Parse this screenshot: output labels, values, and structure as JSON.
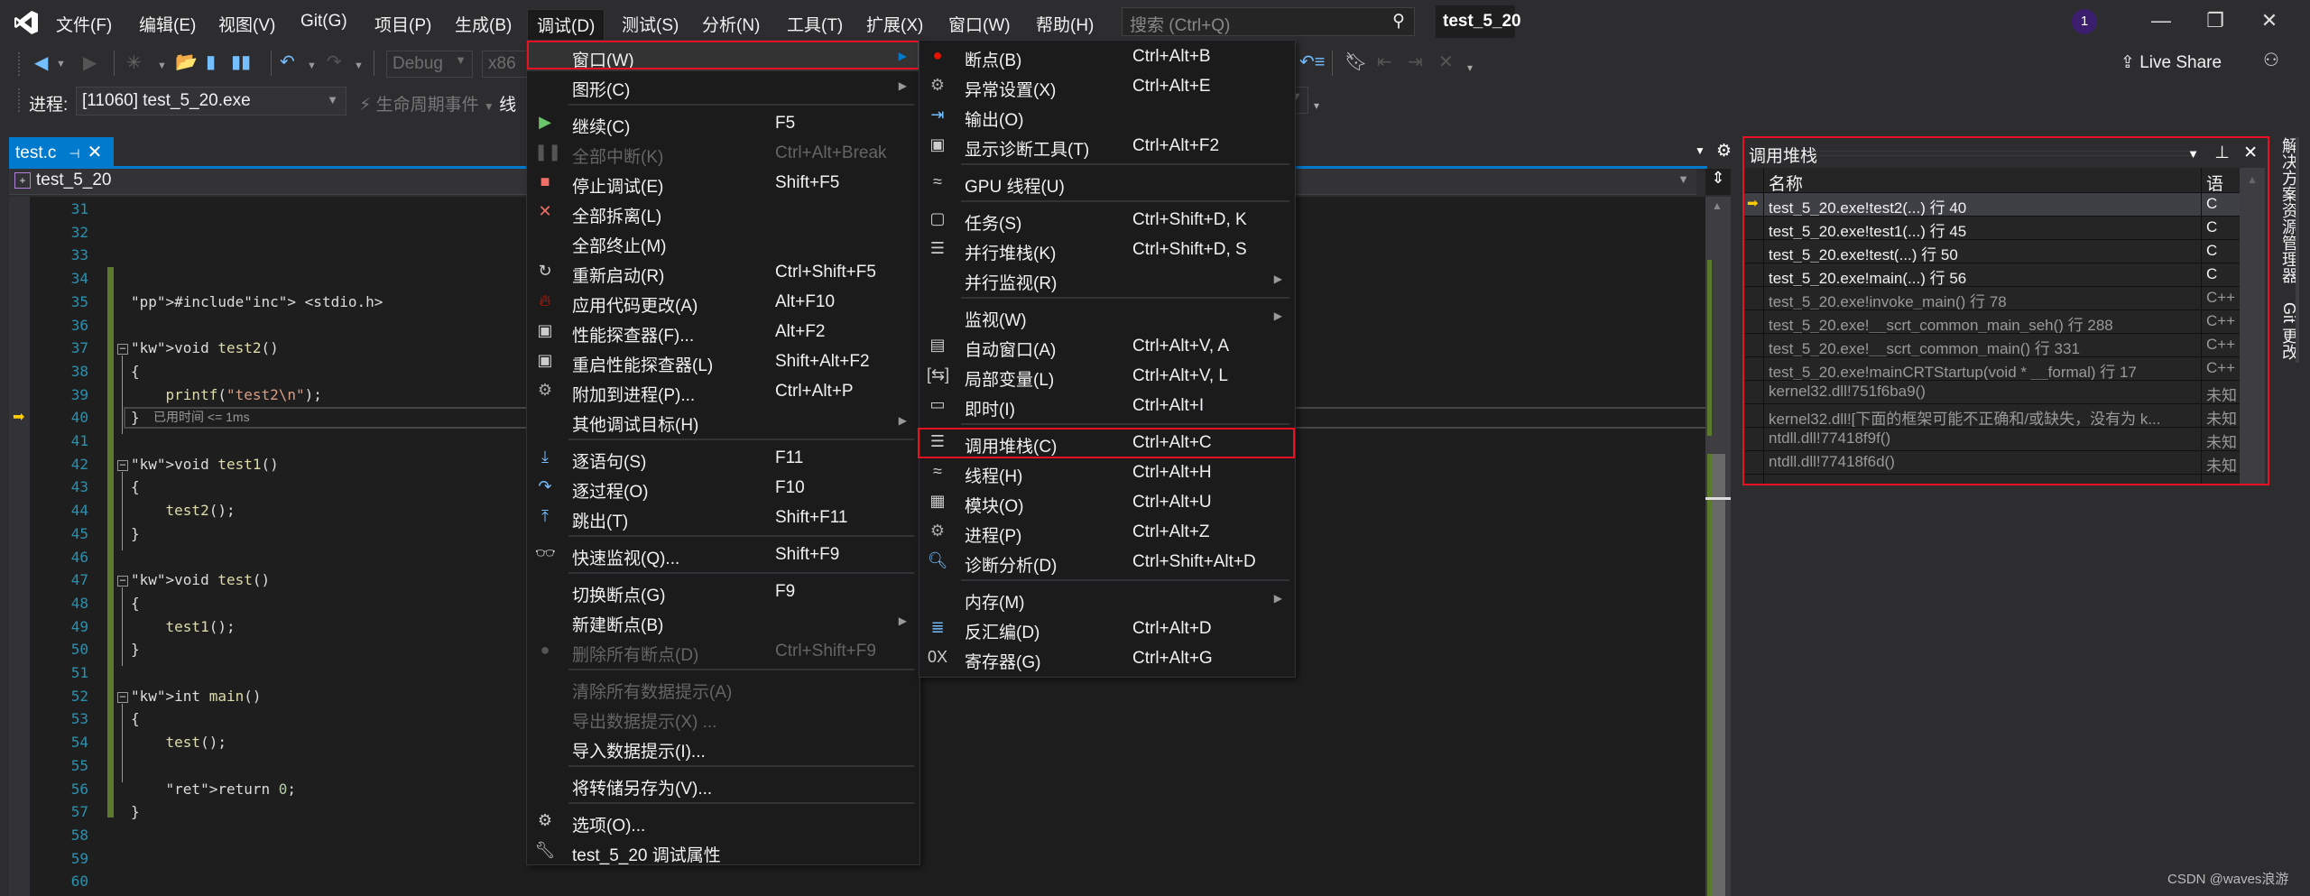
{
  "menubar": {
    "items": [
      "文件(F)",
      "编辑(E)",
      "视图(V)",
      "Git(G)",
      "项目(P)",
      "生成(B)",
      "调试(D)",
      "测试(S)",
      "分析(N)",
      "工具(T)",
      "扩展(X)",
      "窗口(W)",
      "帮助(H)"
    ],
    "active_index": 6,
    "search_placeholder": "搜索 (Ctrl+Q)",
    "solution_name": "test_5_20",
    "notification_count": "1",
    "window_buttons": {
      "minimize": "—",
      "restore": "❐",
      "close": "✕"
    }
  },
  "toolbar": {
    "config": "Debug",
    "platform": "x86",
    "process_label": "进程:",
    "process_value": "[11060] test_5_20.exe",
    "lifecycle_label": "生命周期事件",
    "thread_label": "线",
    "live_share": "Live Share"
  },
  "editor": {
    "tab_label": "test.c",
    "project_nav": "test_5_20",
    "elapsed_time": "已用时间 <= 1ms",
    "current_line": 40,
    "lines": [
      {
        "n": "31",
        "html": ""
      },
      {
        "n": "32",
        "html": ""
      },
      {
        "n": "33",
        "html": ""
      },
      {
        "n": "34",
        "html": ""
      },
      {
        "n": "35",
        "html": "#include <stdio.h>"
      },
      {
        "n": "36",
        "html": ""
      },
      {
        "n": "37",
        "html": "void test2()"
      },
      {
        "n": "38",
        "html": "{"
      },
      {
        "n": "39",
        "html": "    printf(\"test2\\n\");"
      },
      {
        "n": "40",
        "html": "}"
      },
      {
        "n": "41",
        "html": ""
      },
      {
        "n": "42",
        "html": "void test1()"
      },
      {
        "n": "43",
        "html": "{"
      },
      {
        "n": "44",
        "html": "    test2();"
      },
      {
        "n": "45",
        "html": "}"
      },
      {
        "n": "46",
        "html": ""
      },
      {
        "n": "47",
        "html": "void test()"
      },
      {
        "n": "48",
        "html": "{"
      },
      {
        "n": "49",
        "html": "    test1();"
      },
      {
        "n": "50",
        "html": "}"
      },
      {
        "n": "51",
        "html": ""
      },
      {
        "n": "52",
        "html": "int main()"
      },
      {
        "n": "53",
        "html": "{"
      },
      {
        "n": "54",
        "html": "    test();"
      },
      {
        "n": "55",
        "html": ""
      },
      {
        "n": "56",
        "html": "    return 0;"
      },
      {
        "n": "57",
        "html": "}"
      },
      {
        "n": "58",
        "html": ""
      },
      {
        "n": "59",
        "html": ""
      },
      {
        "n": "60",
        "html": ""
      }
    ]
  },
  "debug_menu": {
    "items": [
      {
        "label": "窗口(W)",
        "shortcut": "",
        "icon": "",
        "submenu": true,
        "highlighted": true
      },
      {
        "label": "图形(C)",
        "shortcut": "",
        "icon": "",
        "submenu": true
      },
      {
        "sep": true
      },
      {
        "label": "继续(C)",
        "shortcut": "F5",
        "icon": "play-icon"
      },
      {
        "label": "全部中断(K)",
        "shortcut": "Ctrl+Alt+Break",
        "icon": "pause-icon",
        "disabled": true
      },
      {
        "label": "停止调试(E)",
        "shortcut": "Shift+F5",
        "icon": "stop-icon"
      },
      {
        "label": "全部拆离(L)",
        "shortcut": "",
        "icon": "detach-icon"
      },
      {
        "label": "全部终止(M)",
        "shortcut": "",
        "icon": ""
      },
      {
        "label": "重新启动(R)",
        "shortcut": "Ctrl+Shift+F5",
        "icon": "restart-icon"
      },
      {
        "label": "应用代码更改(A)",
        "shortcut": "Alt+F10",
        "icon": "hot-reload-icon"
      },
      {
        "label": "性能探查器(F)...",
        "shortcut": "Alt+F2",
        "icon": "profiler-icon"
      },
      {
        "label": "重启性能探查器(L)",
        "shortcut": "Shift+Alt+F2",
        "icon": "profiler-icon"
      },
      {
        "label": "附加到进程(P)...",
        "shortcut": "Ctrl+Alt+P",
        "icon": "attach-icon"
      },
      {
        "label": "其他调试目标(H)",
        "shortcut": "",
        "icon": "",
        "submenu": true
      },
      {
        "sep": true
      },
      {
        "label": "逐语句(S)",
        "shortcut": "F11",
        "icon": "step-into-icon"
      },
      {
        "label": "逐过程(O)",
        "shortcut": "F10",
        "icon": "step-over-icon"
      },
      {
        "label": "跳出(T)",
        "shortcut": "Shift+F11",
        "icon": "step-out-icon"
      },
      {
        "sep": true
      },
      {
        "label": "快速监视(Q)...",
        "shortcut": "Shift+F9",
        "icon": "quickwatch-icon"
      },
      {
        "sep": true
      },
      {
        "label": "切换断点(G)",
        "shortcut": "F9",
        "icon": ""
      },
      {
        "label": "新建断点(B)",
        "shortcut": "",
        "icon": "",
        "submenu": true
      },
      {
        "label": "删除所有断点(D)",
        "shortcut": "Ctrl+Shift+F9",
        "icon": "delete-breakpoints-icon",
        "disabled": true
      },
      {
        "sep": true
      },
      {
        "label": "清除所有数据提示(A)",
        "shortcut": "",
        "icon": "",
        "disabled": true
      },
      {
        "label": "导出数据提示(X) ...",
        "shortcut": "",
        "icon": "",
        "disabled": true
      },
      {
        "label": "导入数据提示(I)...",
        "shortcut": "",
        "icon": ""
      },
      {
        "sep": true
      },
      {
        "label": "将转储另存为(V)...",
        "shortcut": "",
        "icon": ""
      },
      {
        "sep": true
      },
      {
        "label": "选项(O)...",
        "shortcut": "",
        "icon": "gear-icon"
      },
      {
        "label": "test_5_20 调试属性",
        "shortcut": "",
        "icon": "wrench-icon"
      }
    ]
  },
  "window_submenu": {
    "items": [
      {
        "label": "断点(B)",
        "shortcut": "Ctrl+Alt+B",
        "icon": "breakpoint-icon"
      },
      {
        "label": "异常设置(X)",
        "shortcut": "Ctrl+Alt+E",
        "icon": "exception-icon"
      },
      {
        "label": "输出(O)",
        "shortcut": "",
        "icon": "output-icon"
      },
      {
        "label": "显示诊断工具(T)",
        "shortcut": "Ctrl+Alt+F2",
        "icon": "diagnostics-icon"
      },
      {
        "sep": true
      },
      {
        "label": "GPU 线程(U)",
        "shortcut": "",
        "icon": "threads-icon"
      },
      {
        "sep": true
      },
      {
        "label": "任务(S)",
        "shortcut": "Ctrl+Shift+D, K",
        "icon": "tasks-icon"
      },
      {
        "label": "并行堆栈(K)",
        "shortcut": "Ctrl+Shift+D, S",
        "icon": "parallel-stacks-icon"
      },
      {
        "label": "并行监视(R)",
        "shortcut": "",
        "icon": "",
        "submenu": true
      },
      {
        "sep": true
      },
      {
        "label": "监视(W)",
        "shortcut": "",
        "icon": "",
        "submenu": true
      },
      {
        "label": "自动窗口(A)",
        "shortcut": "Ctrl+Alt+V, A",
        "icon": "autos-icon"
      },
      {
        "label": "局部变量(L)",
        "shortcut": "Ctrl+Alt+V, L",
        "icon": "locals-icon"
      },
      {
        "label": "即时(I)",
        "shortcut": "Ctrl+Alt+I",
        "icon": "immediate-icon"
      },
      {
        "sep": true
      },
      {
        "label": "调用堆栈(C)",
        "shortcut": "Ctrl+Alt+C",
        "icon": "call-stack-icon",
        "boxed": true
      },
      {
        "label": "线程(H)",
        "shortcut": "Ctrl+Alt+H",
        "icon": "threads-icon"
      },
      {
        "label": "模块(O)",
        "shortcut": "Ctrl+Alt+U",
        "icon": "modules-icon"
      },
      {
        "label": "进程(P)",
        "shortcut": "Ctrl+Alt+Z",
        "icon": "processes-icon"
      },
      {
        "label": "诊断分析(D)",
        "shortcut": "Ctrl+Shift+Alt+D",
        "icon": "diagnostic-analysis-icon"
      },
      {
        "sep": true
      },
      {
        "label": "内存(M)",
        "shortcut": "",
        "icon": "",
        "submenu": true
      },
      {
        "label": "反汇编(D)",
        "shortcut": "Ctrl+Alt+D",
        "icon": "disassembly-icon"
      },
      {
        "label": "寄存器(G)",
        "shortcut": "Ctrl+Alt+G",
        "icon": "registers-icon"
      }
    ]
  },
  "call_stack": {
    "title": "调用堆栈",
    "col_name": "名称",
    "col_lang": "语言",
    "rows": [
      {
        "name": "test_5_20.exe!test2(...) 行 40",
        "lang": "C",
        "current": true,
        "user": true
      },
      {
        "name": "test_5_20.exe!test1(...) 行 45",
        "lang": "C",
        "user": true
      },
      {
        "name": "test_5_20.exe!test(...) 行 50",
        "lang": "C",
        "user": true
      },
      {
        "name": "test_5_20.exe!main(...) 行 56",
        "lang": "C",
        "user": true
      },
      {
        "name": "test_5_20.exe!invoke_main() 行 78",
        "lang": "C++",
        "user": false
      },
      {
        "name": "test_5_20.exe!__scrt_common_main_seh() 行 288",
        "lang": "C++",
        "user": false
      },
      {
        "name": "test_5_20.exe!__scrt_common_main() 行 331",
        "lang": "C++",
        "user": false
      },
      {
        "name": "test_5_20.exe!mainCRTStartup(void * __formal) 行 17",
        "lang": "C++",
        "user": false
      },
      {
        "name": "kernel32.dll!751f6ba9()",
        "lang": "未知",
        "user": false
      },
      {
        "name": "kernel32.dll![下面的框架可能不正确和/或缺失，没有为 k...",
        "lang": "未知",
        "user": false
      },
      {
        "name": "ntdll.dll!77418f9f()",
        "lang": "未知",
        "user": false
      },
      {
        "name": "ntdll.dll!77418f6d()",
        "lang": "未知",
        "user": false
      }
    ]
  },
  "side_tabs": [
    "解决方案资源管理器",
    "Git 更改"
  ],
  "watermark": "CSDN @waves浪游",
  "colors": {
    "accent": "#007acc",
    "highlight_box": "#e81123",
    "line_number": "#2b91af"
  }
}
